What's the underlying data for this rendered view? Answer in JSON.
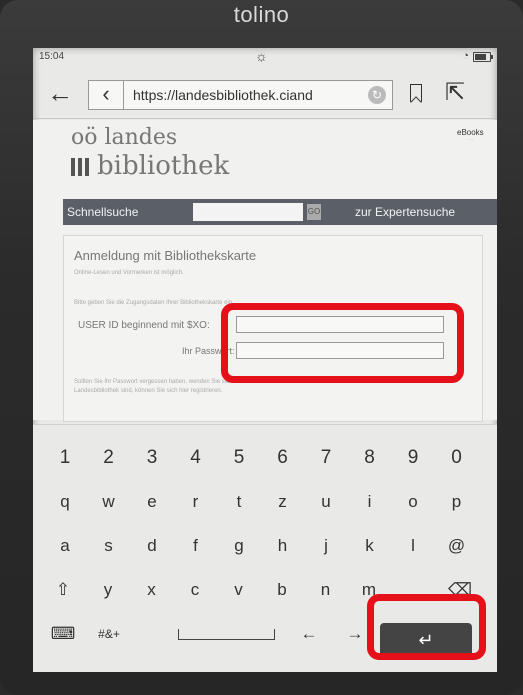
{
  "device": {
    "brand": "tolino"
  },
  "status_bar": {
    "time": "15:04"
  },
  "browser": {
    "url": "https://landesbibliothek.ciand"
  },
  "site": {
    "logo_line1": "oö landes",
    "logo_line2": "bibliothek",
    "ebooks_badge": "eBooks",
    "quick_search_label": "Schnellsuche",
    "quick_search_go": "GO",
    "expert_search_label": "zur Expertensuche"
  },
  "login": {
    "title": "Anmeldung mit Bibliothekskarte",
    "subtitle": "Online-Lesen und Vormerken ist möglich.",
    "help": "Bitte geben Sie die Zugangsdaten Ihrer Bibliothekskarte ein.",
    "userid_label": "USER ID beginnend mit $XO:",
    "userid_value": "",
    "password_label": "Ihr Passwort:",
    "password_value": "",
    "forgot_text": "Sollten Sie Ihr Passwort vergessen haben, wenden Sie sich bitte an die Bibliothek. Wenn Sie noch keine Leserin bzw. kein Leser der Oö. Landesbibliothek sind, können Sie sich hier registrieren."
  },
  "keyboard": {
    "numbers": [
      "1",
      "2",
      "3",
      "4",
      "5",
      "6",
      "7",
      "8",
      "9",
      "0"
    ],
    "row1": [
      "q",
      "w",
      "e",
      "r",
      "t",
      "z",
      "u",
      "i",
      "o",
      "p"
    ],
    "row2": [
      "a",
      "s",
      "d",
      "f",
      "g",
      "h",
      "j",
      "k",
      "l",
      "@"
    ],
    "row3": [
      "y",
      "x",
      "c",
      "v",
      "b",
      "n",
      "m"
    ],
    "shift_symbol": "⇧",
    "backspace_symbol": "⌫",
    "keyboard_symbol": "⌨",
    "symbols_label": "#&+",
    "left_arrow": "←",
    "right_arrow": "→",
    "enter_symbol": "↵"
  },
  "colors": {
    "highlight": "#e6101b",
    "screen_bg": "#e9e9e7",
    "search_bar": "#5a5f68"
  }
}
